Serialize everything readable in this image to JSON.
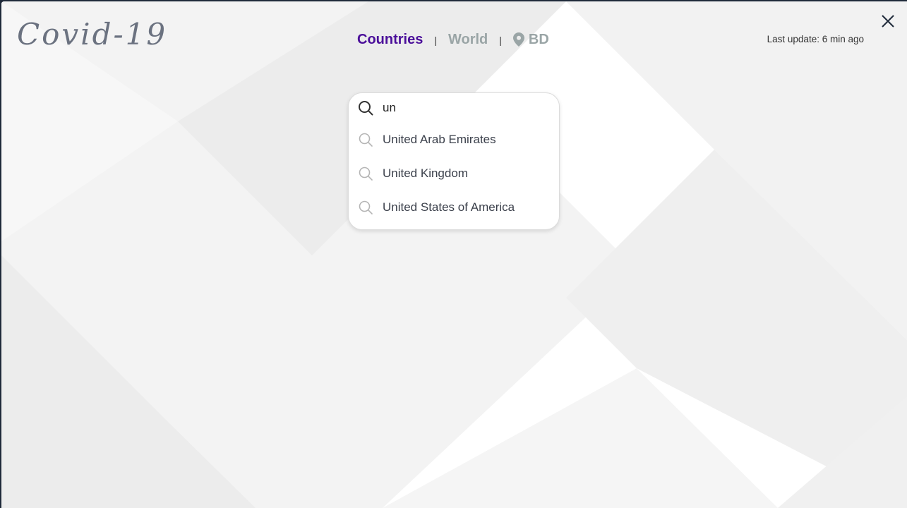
{
  "app": {
    "logo": "Covid-19"
  },
  "nav": {
    "countries": "Countries",
    "separator": "|",
    "world": "World",
    "local": "BD",
    "local_icon": "map-pin-icon",
    "active_color": "#4b0f9a",
    "inactive_color": "#9aa5a6"
  },
  "status": {
    "last_update": "Last update: 6 min ago"
  },
  "close": {
    "icon": "close-icon"
  },
  "search": {
    "value": "un",
    "icon": "search-icon",
    "suggestions": [
      {
        "label": "United Arab Emirates"
      },
      {
        "label": "United Kingdom"
      },
      {
        "label": "United States of America"
      }
    ]
  }
}
